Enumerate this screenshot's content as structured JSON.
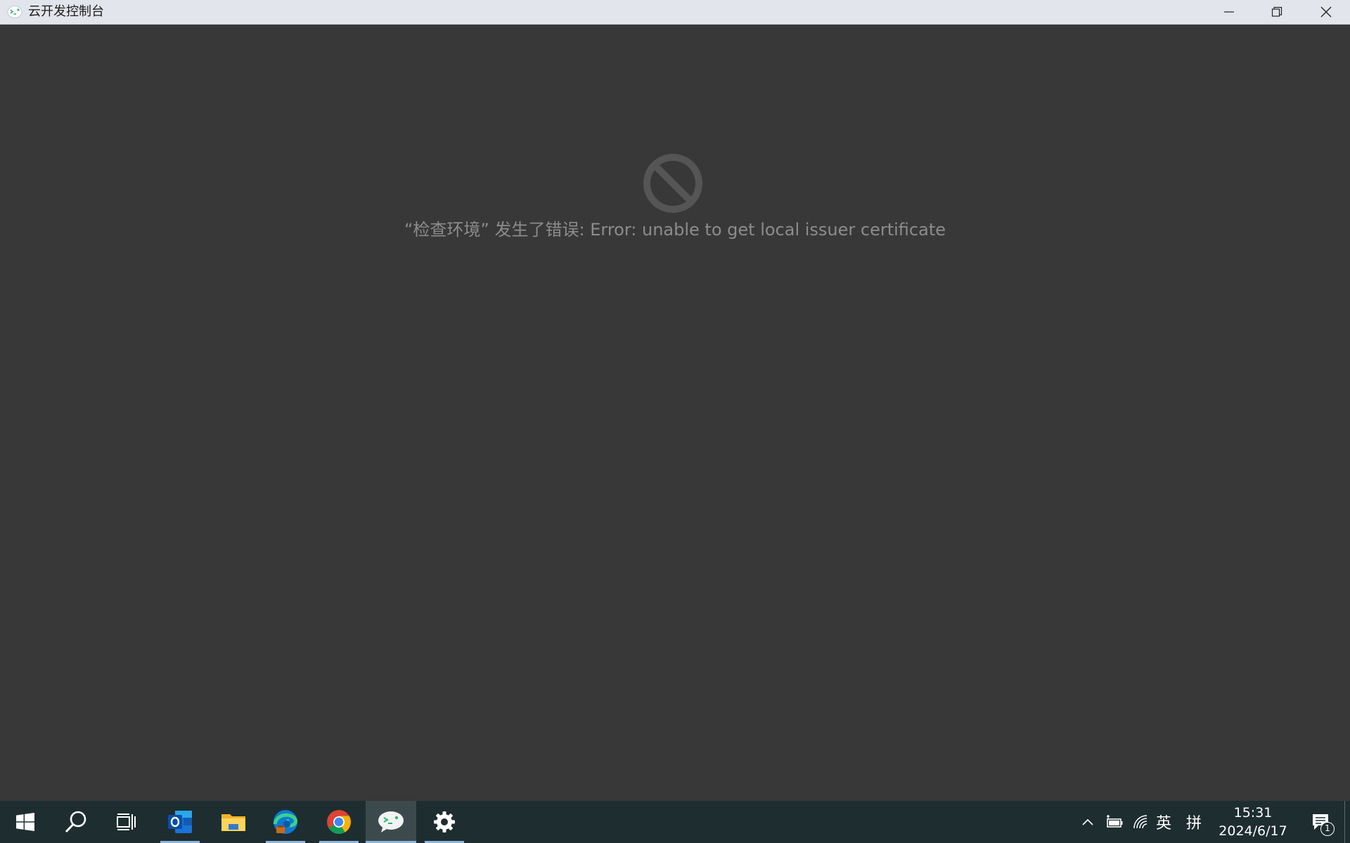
{
  "window": {
    "title": "云开发控制台",
    "controls": {
      "minimize_icon": "minimize-icon",
      "maximize_icon": "restore-icon",
      "close_icon": "close-icon"
    }
  },
  "main": {
    "error_icon": "prohibited-icon",
    "error_message": "“检查环境” 发生了错误: Error: unable to get local issuer certificate",
    "colors": {
      "background": "#383838",
      "error_text": "#8c8c8c",
      "error_icon": "#555555"
    }
  },
  "taskbar": {
    "apps": [
      {
        "name": "start",
        "icon": "windows-logo-icon"
      },
      {
        "name": "search",
        "icon": "search-icon"
      },
      {
        "name": "task-view",
        "icon": "task-view-icon"
      },
      {
        "name": "outlook",
        "icon": "outlook-icon"
      },
      {
        "name": "file-explorer",
        "icon": "folder-icon"
      },
      {
        "name": "edge",
        "icon": "edge-icon"
      },
      {
        "name": "chrome",
        "icon": "chrome-icon"
      },
      {
        "name": "cloud-console",
        "icon": "cloud-console-icon",
        "active": true
      },
      {
        "name": "settings",
        "icon": "gear-icon"
      }
    ],
    "tray": {
      "ime_language": "英",
      "ime_mode": "拼",
      "time": "15:31",
      "date": "2024/6/17",
      "notification_count": "1"
    }
  }
}
